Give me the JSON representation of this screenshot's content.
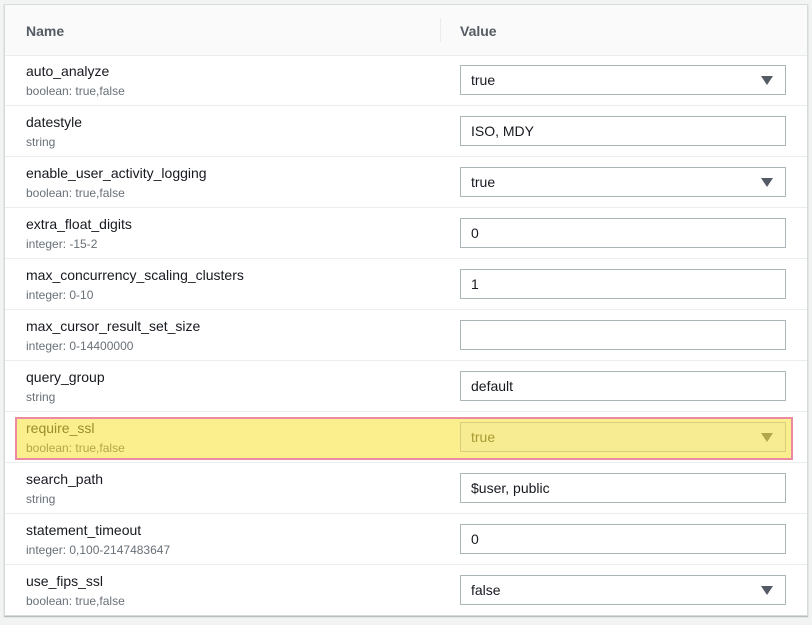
{
  "table": {
    "headers": {
      "name": "Name",
      "value": "Value"
    },
    "rows": [
      {
        "name": "auto_analyze",
        "type": "boolean: true,false",
        "control": "select",
        "value": "true"
      },
      {
        "name": "datestyle",
        "type": "string",
        "control": "input",
        "value": "ISO, MDY"
      },
      {
        "name": "enable_user_activity_logging",
        "type": "boolean: true,false",
        "control": "select",
        "value": "true"
      },
      {
        "name": "extra_float_digits",
        "type": "integer: -15-2",
        "control": "input",
        "value": "0"
      },
      {
        "name": "max_concurrency_scaling_clusters",
        "type": "integer: 0-10",
        "control": "input",
        "value": "1"
      },
      {
        "name": "max_cursor_result_set_size",
        "type": "integer: 0-14400000",
        "control": "input",
        "value": ""
      },
      {
        "name": "query_group",
        "type": "string",
        "control": "input",
        "value": "default"
      },
      {
        "name": "require_ssl",
        "type": "boolean: true,false",
        "control": "select",
        "value": "true",
        "highlighted": true
      },
      {
        "name": "search_path",
        "type": "string",
        "control": "input",
        "value": "$user, public"
      },
      {
        "name": "statement_timeout",
        "type": "integer: 0,100-2147483647",
        "control": "input",
        "value": "0"
      },
      {
        "name": "use_fips_ssl",
        "type": "boolean: true,false",
        "control": "select",
        "value": "false"
      }
    ]
  },
  "colors": {
    "highlight_fill": "#fbef8d",
    "highlight_border": "#ec8aa2",
    "text": "#16191f",
    "subtext": "#687078"
  },
  "icons": {
    "select_arrow": "caret-down-icon"
  }
}
